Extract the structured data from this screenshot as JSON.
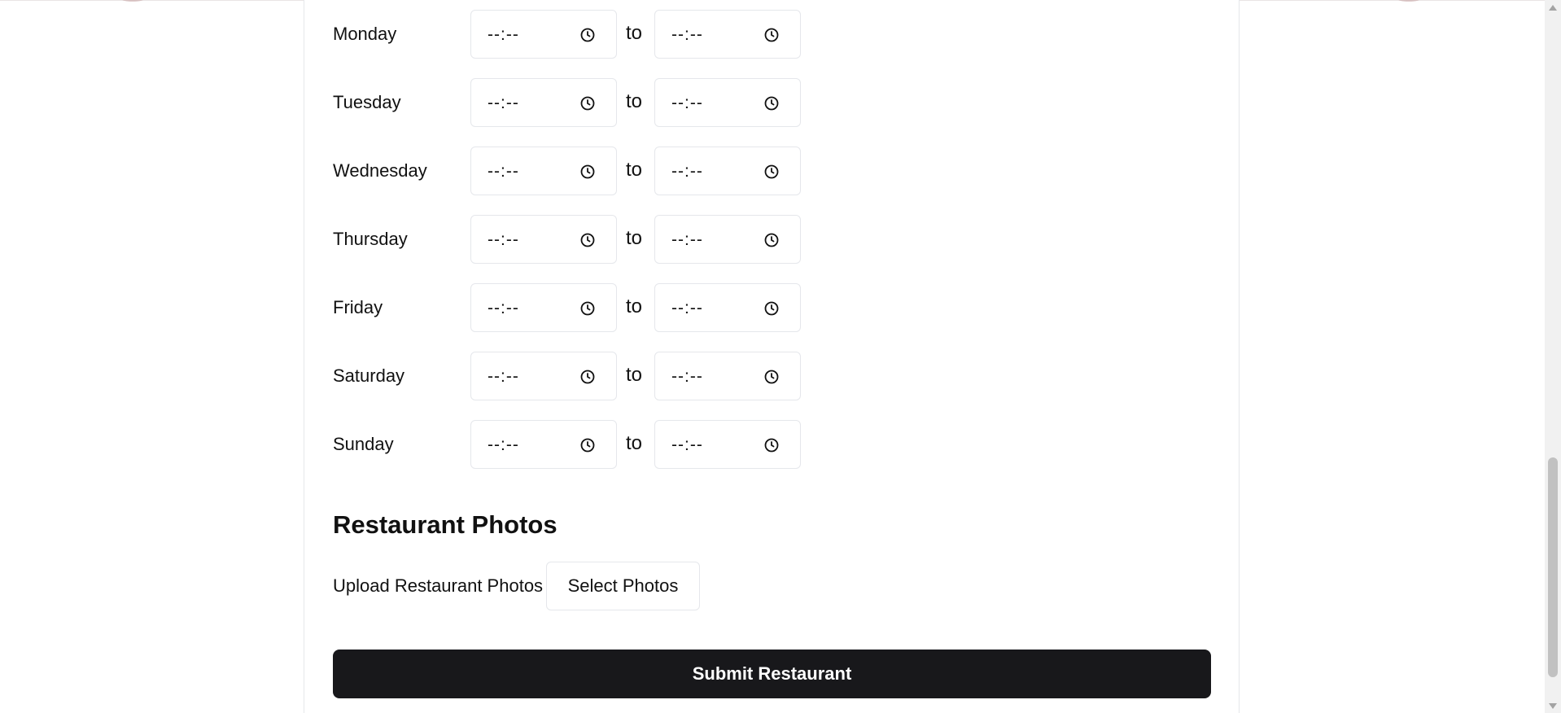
{
  "hours": {
    "separator": "to",
    "days": [
      {
        "day": "Monday",
        "open": "--:--",
        "close": "--:--"
      },
      {
        "day": "Tuesday",
        "open": "--:--",
        "close": "--:--"
      },
      {
        "day": "Wednesday",
        "open": "--:--",
        "close": "--:--"
      },
      {
        "day": "Thursday",
        "open": "--:--",
        "close": "--:--"
      },
      {
        "day": "Friday",
        "open": "--:--",
        "close": "--:--"
      },
      {
        "day": "Saturday",
        "open": "--:--",
        "close": "--:--"
      },
      {
        "day": "Sunday",
        "open": "--:--",
        "close": "--:--"
      }
    ],
    "input_icon": "clock-icon"
  },
  "photos": {
    "section_title": "Restaurant Photos",
    "upload_label": "Upload Restaurant Photos",
    "select_button_label": "Select Photos"
  },
  "submit": {
    "label": "Submit Restaurant"
  },
  "colors": {
    "submit_background": "#18181b",
    "submit_text": "#ffffff",
    "border": "#e5e7eb",
    "text": "#111111"
  }
}
